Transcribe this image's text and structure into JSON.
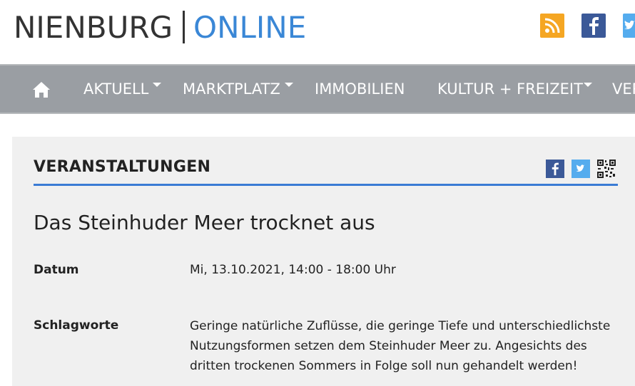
{
  "site": {
    "logo_left": "NIENBURG",
    "logo_right": "ONLINE"
  },
  "header_icons": [
    "rss-icon",
    "facebook-icon",
    "twitter-icon"
  ],
  "nav": {
    "items": [
      {
        "label": "AKTUELL",
        "dropdown": true
      },
      {
        "label": "MARKTPLATZ",
        "dropdown": true
      },
      {
        "label": "IMMOBILIEN",
        "dropdown": false
      },
      {
        "label": "KULTUR + FREIZEIT",
        "dropdown": true
      },
      {
        "label": "VER",
        "dropdown": false
      }
    ]
  },
  "section": {
    "title": "VERANSTALTUNGEN"
  },
  "event": {
    "title": "Das Steinhuder Meer trocknet aus",
    "date_label": "Datum",
    "date_value": "Mi, 13.10.2021, 14:00 - 18:00 Uhr",
    "tags_label": "Schlagworte",
    "tags_lines": [
      "Geringe natürliche Zuflüsse, die geringe Tiefe und unterschiedlichste",
      "Nutzungsformen setzen dem Steinhuder Meer zu. Angesichts des",
      "dritten trockenen Sommers in Folge soll nun gehandelt werden!"
    ]
  },
  "colors": {
    "accent": "#3a87d6",
    "nav_bg": "#9a9ea3",
    "content_bg": "#f0f0f0",
    "rss": "#f5a623",
    "facebook": "#3b5998",
    "twitter": "#55acee"
  }
}
